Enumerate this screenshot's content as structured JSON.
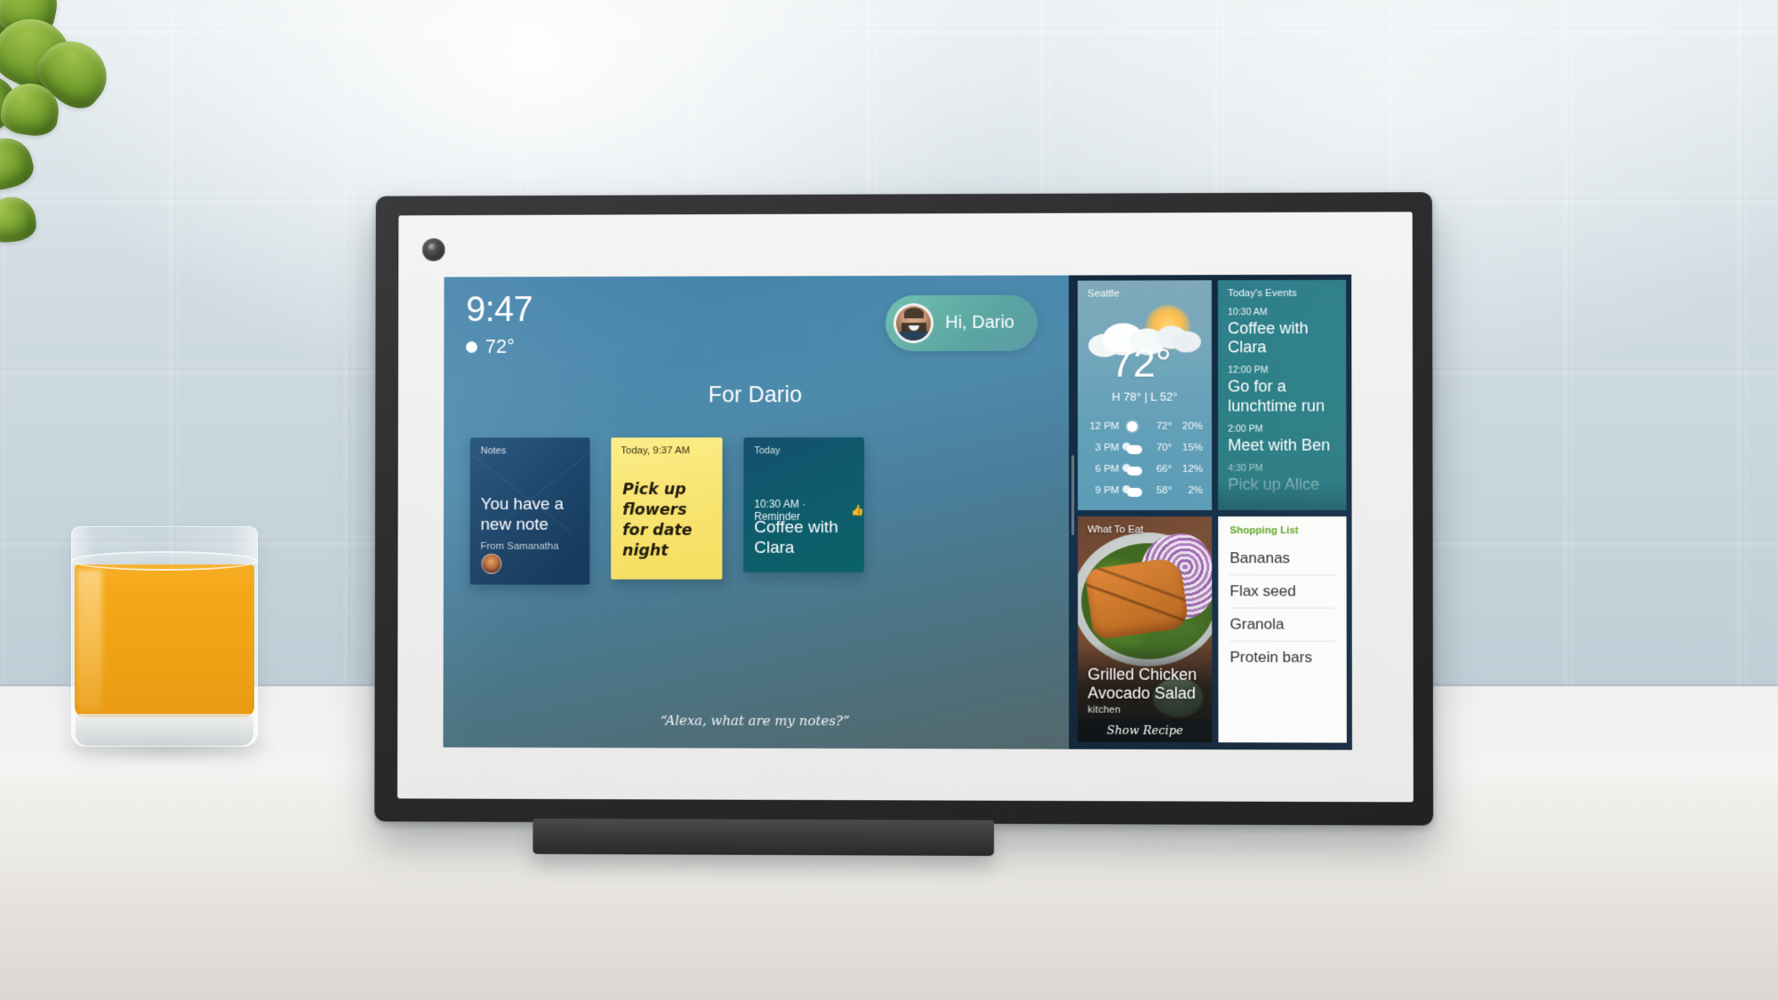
{
  "scene": {
    "plant": "jade-plant",
    "wall": "white-subway-tile",
    "drink": "orange-juice-glass"
  },
  "device": {
    "name": "smart-display",
    "camera": "front-camera"
  },
  "home": {
    "clock": {
      "time": "9:47",
      "temp": "72°",
      "condition_icon": "sun-icon"
    },
    "greeting": {
      "text": "Hi, Dario",
      "avatar": "user-avatar"
    },
    "section_title": "For Dario",
    "alexa_prompt": "“Alexa, what are my notes?”",
    "cards": {
      "note": {
        "kicker": "Notes",
        "headline": "You have a new note",
        "from": "From Samanatha"
      },
      "sticky": {
        "kicker": "Today, 9:37 AM",
        "text": "Pick up flowers for date night"
      },
      "event": {
        "kicker": "Today",
        "meta": "10:30 AM · Reminder",
        "meta_icon": "thumbs-up-icon",
        "title": "Coffee with Clara"
      }
    }
  },
  "widgets": {
    "weather": {
      "city": "Seattle",
      "temp": "72°",
      "high_low": "H 78° | L 52°",
      "icon": "partly-sunny-icon",
      "hours": [
        {
          "time": "12 PM",
          "icon": "sun-icon",
          "temp": "72°",
          "precip": "20%"
        },
        {
          "time": "3 PM",
          "icon": "partly-cloudy-icon",
          "temp": "70°",
          "precip": "15%"
        },
        {
          "time": "6 PM",
          "icon": "partly-cloudy-icon",
          "temp": "66°",
          "precip": "12%"
        },
        {
          "time": "9 PM",
          "icon": "partly-cloudy-icon",
          "temp": "58°",
          "precip": "2%"
        }
      ]
    },
    "events": {
      "kicker": "Today's Events",
      "items": [
        {
          "time": "10:30 AM",
          "name": "Coffee with Clara"
        },
        {
          "time": "12:00 PM",
          "name": "Go for a lunchtime run"
        },
        {
          "time": "2:00 PM",
          "name": "Meet with Ben"
        },
        {
          "time": "4:30 PM",
          "name": "Pick up Alice"
        }
      ]
    },
    "recipe": {
      "kicker": "What To Eat",
      "title": "Grilled Chicken Avocado Salad",
      "brand": "kitchen",
      "cta": "Show Recipe"
    },
    "shopping": {
      "kicker": "Shopping List",
      "kicker_color": "#5fa524",
      "items": [
        "Bananas",
        "Flax seed",
        "Granola",
        "Protein bars"
      ]
    }
  }
}
